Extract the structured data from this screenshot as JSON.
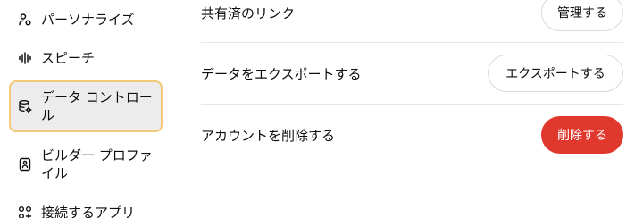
{
  "sidebar": {
    "items": [
      {
        "label": "パーソナライズ",
        "icon": "personalize-icon"
      },
      {
        "label": "スピーチ",
        "icon": "speech-waveform-icon"
      },
      {
        "label": "データ コントロール",
        "icon": "data-controls-icon",
        "active": true
      },
      {
        "label": "ビルダー プロファイル",
        "icon": "builder-profile-icon"
      },
      {
        "label": "接続するアプリ",
        "icon": "connected-apps-icon"
      }
    ]
  },
  "settings": {
    "shared_links": {
      "label": "共有済のリンク",
      "button": "管理する"
    },
    "export_data": {
      "label": "データをエクスポートする",
      "button": "エクスポートする"
    },
    "delete_account": {
      "label": "アカウントを削除する",
      "button": "削除する"
    }
  },
  "colors": {
    "active_bg": "#ececec",
    "active_border": "#f3c977",
    "danger": "#e0382d"
  }
}
